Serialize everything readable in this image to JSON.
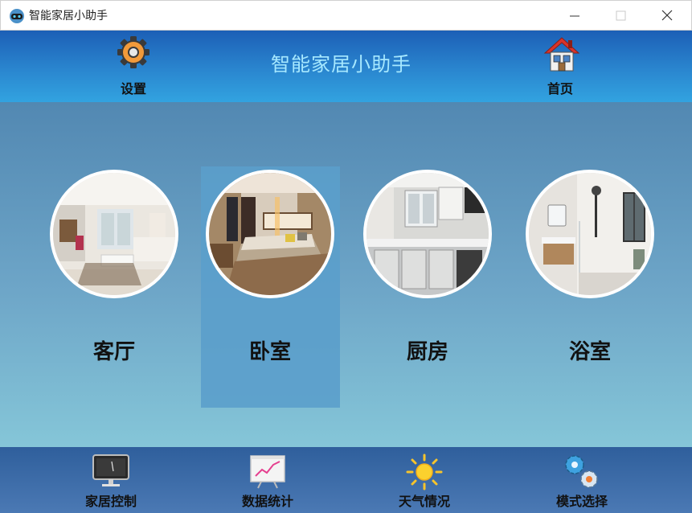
{
  "window": {
    "title": "智能家居小助手"
  },
  "header": {
    "title": "智能家居小助手",
    "settings_label": "设置",
    "home_label": "首页"
  },
  "rooms": [
    {
      "label": "客厅",
      "icon": "living-room-photo"
    },
    {
      "label": "卧室",
      "icon": "bedroom-photo",
      "selected": true
    },
    {
      "label": "厨房",
      "icon": "kitchen-photo"
    },
    {
      "label": "浴室",
      "icon": "bathroom-photo"
    }
  ],
  "nav": [
    {
      "label": "家居控制",
      "icon": "monitor-icon"
    },
    {
      "label": "数据统计",
      "icon": "chart-board-icon"
    },
    {
      "label": "天气情况",
      "icon": "sun-icon"
    },
    {
      "label": "模式选择",
      "icon": "gears-icon"
    }
  ],
  "colors": {
    "header_title": "#a6e8ff",
    "selection": "#5b9fcb",
    "settings_gear": "#f29a3a",
    "home_roof": "#d9342b"
  }
}
